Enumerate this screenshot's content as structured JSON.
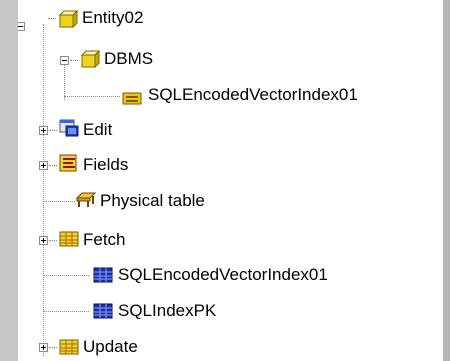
{
  "tree": {
    "items": [
      {
        "label": "Entity02",
        "icon": "entity-box-icon",
        "expander": "minus"
      },
      {
        "label": "DBMS",
        "icon": "dbms-box-icon",
        "expander": "minus"
      },
      {
        "label": "SQLEncodedVectorIndex01",
        "icon": "index-tab-icon",
        "expander": "none"
      },
      {
        "label": "Edit",
        "icon": "edit-window-icon",
        "expander": "plus"
      },
      {
        "label": "Fields",
        "icon": "fields-icon",
        "expander": "plus"
      },
      {
        "label": "Physical table",
        "icon": "table-icon",
        "expander": "none"
      },
      {
        "label": "Fetch",
        "icon": "fetch-grid-icon",
        "expander": "plus"
      },
      {
        "label": "SQLEncodedVectorIndex01",
        "icon": "sql-index-blue-icon",
        "expander": "none"
      },
      {
        "label": "SQLIndexPK",
        "icon": "sql-index-blue-icon",
        "expander": "none"
      },
      {
        "label": "Update",
        "icon": "update-grid-icon",
        "expander": "plus"
      }
    ]
  }
}
